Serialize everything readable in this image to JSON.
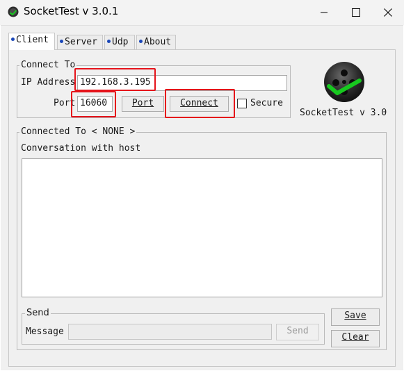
{
  "window": {
    "title": "SocketTest v 3.0.1"
  },
  "icons": {
    "app": "socket-app-icon",
    "minimize": "minimize-icon",
    "maximize": "maximize-icon",
    "close": "close-icon",
    "logo": "sockettest-logo-icon",
    "checkmark": "check-icon"
  },
  "tabs": [
    {
      "label": "Client",
      "active": true
    },
    {
      "label": "Server",
      "active": false
    },
    {
      "label": "Udp",
      "active": false
    },
    {
      "label": "About",
      "active": false
    }
  ],
  "connect_group": {
    "legend": "Connect To",
    "ip_label": "IP Address",
    "ip_value": "192.168.3.195",
    "port_label": "Port",
    "port_value": "16060",
    "port_button": "Port",
    "connect_button": "Connect",
    "secure_label": "Secure",
    "secure_checked": false
  },
  "logo": {
    "caption": "SocketTest v 3.0"
  },
  "conversation_group": {
    "legend": "Connected To < NONE >",
    "conversation_label": "Conversation with host",
    "conversation_text": ""
  },
  "send_group": {
    "legend": "Send",
    "message_label": "Message",
    "message_value": "",
    "send_button": "Send"
  },
  "buttons": {
    "save": "Save",
    "clear": "Clear"
  },
  "colors": {
    "highlight": "#e5131a",
    "accent": "#1a47b8",
    "logo_check": "#17c81f"
  }
}
